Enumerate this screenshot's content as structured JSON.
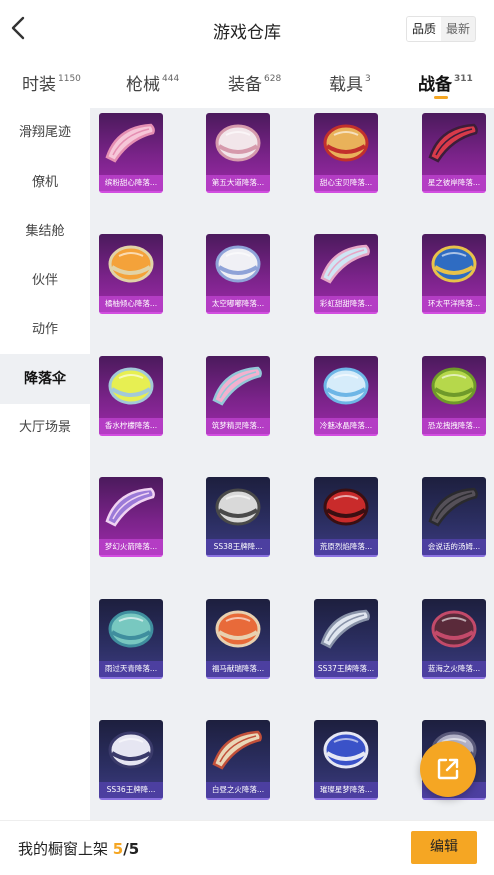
{
  "header": {
    "title": "游戏仓库",
    "sort_options": [
      "品质",
      "最新"
    ],
    "sort_selected": "品质"
  },
  "tabs": [
    {
      "label": "时装",
      "count": "1150"
    },
    {
      "label": "枪械",
      "count": "444"
    },
    {
      "label": "装备",
      "count": "628"
    },
    {
      "label": "载具",
      "count": "3"
    },
    {
      "label": "战备",
      "count": "311",
      "active": true
    }
  ],
  "sidebar": {
    "items": [
      "滑翔尾迹",
      "僚机",
      "集结舱",
      "伙伴",
      "动作",
      "降落伞",
      "大厅场景"
    ],
    "active_index": 5
  },
  "items": [
    {
      "name": "缤粉甜心降落...",
      "rarity": "purple",
      "icon": "parachute-pink-heart"
    },
    {
      "name": "第五大道降落...",
      "rarity": "purple",
      "icon": "parachute-fifth-avenue"
    },
    {
      "name": "甜心宝贝降落...",
      "rarity": "purple",
      "icon": "parachute-sweetheart"
    },
    {
      "name": "星之彼岸降落...",
      "rarity": "purple",
      "icon": "parachute-starry-shore"
    },
    {
      "name": "橘柚倾心降落...",
      "rarity": "purple",
      "icon": "parachute-citrus"
    },
    {
      "name": "太空嘟嘟降落...",
      "rarity": "purple",
      "icon": "parachute-space"
    },
    {
      "name": "彩虹甜甜降落...",
      "rarity": "purple",
      "icon": "parachute-rainbow"
    },
    {
      "name": "环太平洋降落...",
      "rarity": "purple",
      "icon": "parachute-pacific-rim"
    },
    {
      "name": "香水柠檬降落...",
      "rarity": "purple",
      "icon": "parachute-lemon"
    },
    {
      "name": "筑梦精灵降落...",
      "rarity": "purple",
      "icon": "parachute-dream-elf"
    },
    {
      "name": "冷魅冰晶降落...",
      "rarity": "purple",
      "icon": "parachute-ice-crystal"
    },
    {
      "name": "恐龙拽拽降落...",
      "rarity": "purple",
      "icon": "parachute-dinosaur"
    },
    {
      "name": "梦幻火箭降落...",
      "rarity": "purple",
      "icon": "parachute-rocket"
    },
    {
      "name": "SS38王牌降...",
      "rarity": "navy",
      "icon": "parachute-ss38"
    },
    {
      "name": "荒原烈焰降落...",
      "rarity": "navy",
      "icon": "parachute-wasteland-flame"
    },
    {
      "name": "会说话的汤姆...",
      "rarity": "navy",
      "icon": "parachute-talking-tom"
    },
    {
      "name": "雨过天青降落...",
      "rarity": "navy",
      "icon": "parachute-azure"
    },
    {
      "name": "福马献瑞降落...",
      "rarity": "navy",
      "icon": "parachute-lucky-horse"
    },
    {
      "name": "SS37王牌降落...",
      "rarity": "navy",
      "icon": "parachute-ss37"
    },
    {
      "name": "蓝海之火降落...",
      "rarity": "navy",
      "icon": "parachute-blue-sea-fire"
    },
    {
      "name": "SS36王牌降...",
      "rarity": "navy",
      "icon": "parachute-ss36"
    },
    {
      "name": "白昼之火降落...",
      "rarity": "navy",
      "icon": "parachute-daylight-fire"
    },
    {
      "name": "璀璨星梦降落...",
      "rarity": "navy",
      "icon": "parachute-star-dream"
    },
    {
      "name": "",
      "rarity": "navy",
      "icon": "parachute-partial"
    }
  ],
  "footer": {
    "label": "我的橱窗上架",
    "current": "5",
    "separator": "/",
    "total": "5",
    "edit_label": "编辑"
  },
  "floating_button": {
    "icon": "share-external-icon"
  },
  "colors": {
    "accent": "#f5a623",
    "grid_bg": "#eef0f3",
    "rarity_purple": "#b43dc4",
    "rarity_navy": "#4c3fa0"
  }
}
